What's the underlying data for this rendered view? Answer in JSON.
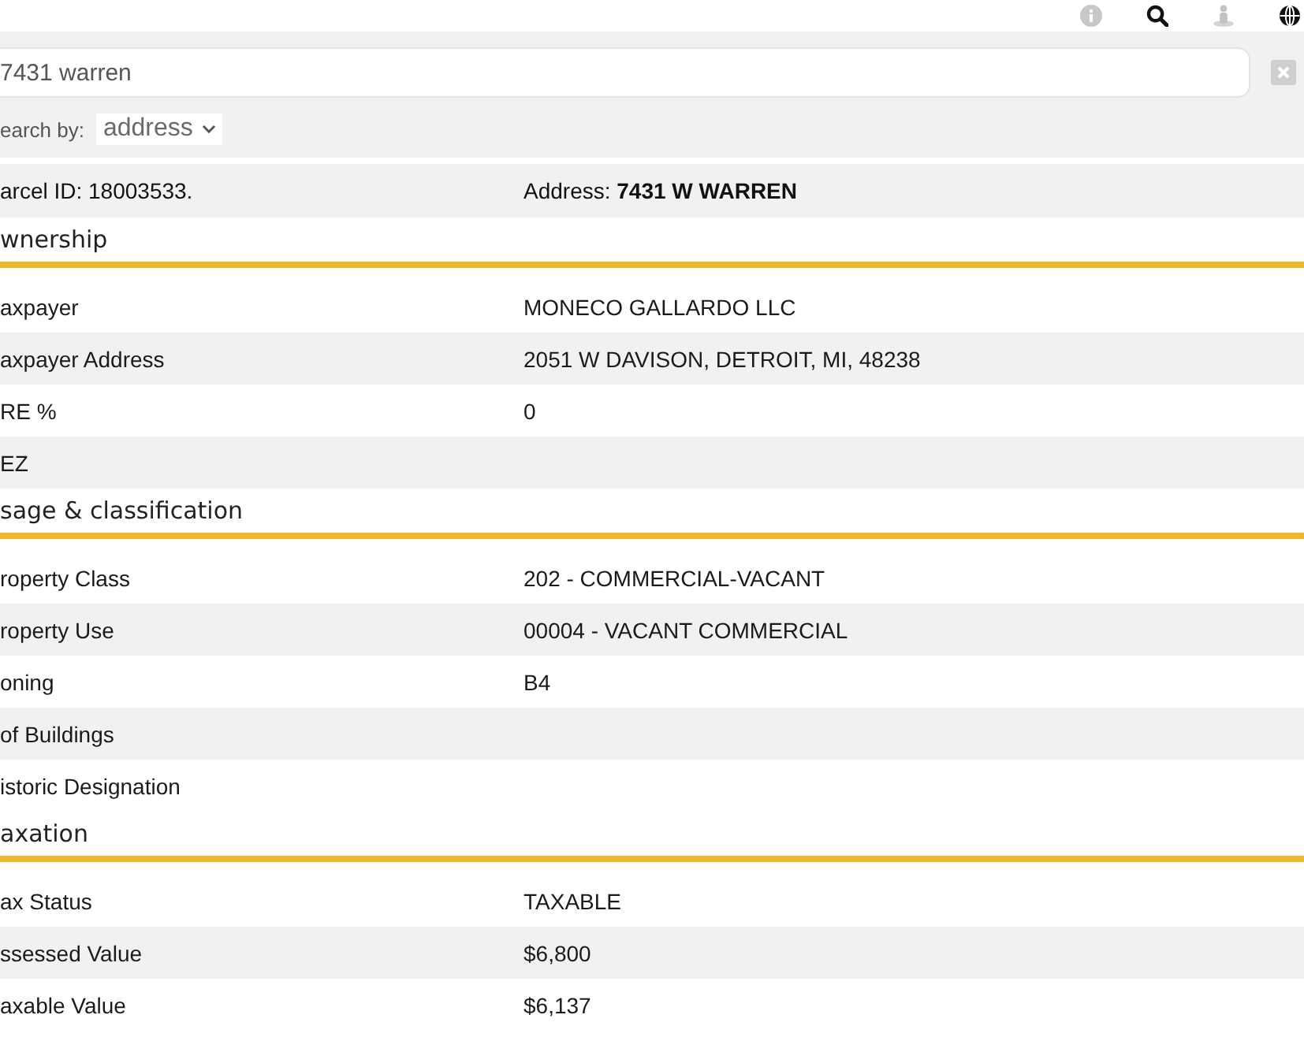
{
  "search": {
    "value": "7431 warren",
    "search_by_label": "earch by:",
    "search_by": "address"
  },
  "parcel": {
    "parcel_id": "arcel ID: 18003533.",
    "address": "Address: **7431 W WARREN**"
  },
  "sections": [
    {
      "title": "wnership",
      "rows": [
        {
          "label": "axpayer",
          "value": "MONECO GALLARDO LLC"
        },
        {
          "label": "axpayer Address",
          "value": "2051 W DAVISON, DETROIT, MI, 48238"
        },
        {
          "label": "RE %",
          "value": "0"
        },
        {
          "label": "EZ"
        }
      ]
    },
    {
      "title": "sage & classification",
      "rows": [
        {
          "label": "roperty Class",
          "value": "202 - COMMERCIAL-VACANT"
        },
        {
          "label": "roperty Use",
          "value": "00004 - VACANT COMMERCIAL"
        },
        {
          "label": "oning",
          "value": "B4"
        },
        {
          "label": "of Buildings"
        },
        {
          "label": "istoric Designation"
        }
      ]
    },
    {
      "title": "axation",
      "rows": [
        {
          "label": "ax Status",
          "value": "TAXABLE"
        },
        {
          "label": "ssessed Value",
          "value": "$6,800"
        },
        {
          "label": "axable Value",
          "value": "$6,137"
        }
      ]
    }
  ]
}
